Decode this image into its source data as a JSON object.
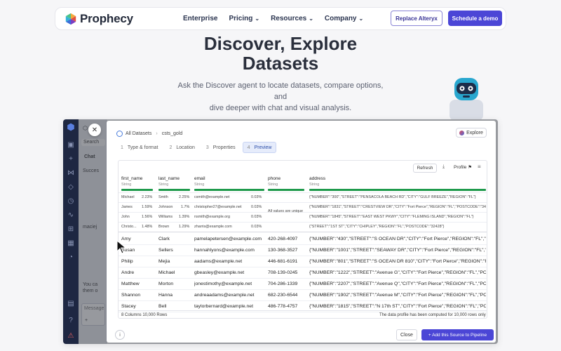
{
  "nav": {
    "brand": "Prophecy",
    "links": [
      {
        "label": "Enterprise",
        "dropdown": false
      },
      {
        "label": "Pricing",
        "dropdown": true
      },
      {
        "label": "Resources",
        "dropdown": true
      },
      {
        "label": "Company",
        "dropdown": true
      }
    ],
    "secondary_button": "Replace Alteryx",
    "primary_button": "Schedule a demo"
  },
  "hero": {
    "title_line1": "Discover, Explore",
    "title_line2": "Datasets",
    "subtitle_line1": "Ask the Discover agent to locate datasets, compare options, and",
    "subtitle_line2": "dive deeper with chat and visual analysis."
  },
  "chat_panel": {
    "tab": "Chat",
    "search": "Search",
    "status": "Succes",
    "user": "maciej",
    "message_placeholder": "Message",
    "snippet1": "You ca",
    "snippet2": "them o"
  },
  "modal": {
    "breadcrumb_root": "All Datasets",
    "breadcrumb_current": "csts_gold",
    "explore_button": "Explore",
    "steps": [
      {
        "num": "1",
        "label": "Type & format"
      },
      {
        "num": "2",
        "label": "Location"
      },
      {
        "num": "3",
        "label": "Properties"
      },
      {
        "num": "4",
        "label": "Preview"
      }
    ],
    "toolbar": {
      "refresh": "Refresh",
      "profile": "Profile"
    },
    "columns": [
      {
        "name": "first_name",
        "type": "String"
      },
      {
        "name": "last_name",
        "type": "String"
      },
      {
        "name": "email",
        "type": "String"
      },
      {
        "name": "phone",
        "type": "String"
      },
      {
        "name": "address",
        "type": "String"
      }
    ],
    "profile": {
      "first_name": [
        [
          "Michael",
          "2.23%"
        ],
        [
          "James",
          "1.59%"
        ],
        [
          "John",
          "1.56%"
        ],
        [
          "Christo...",
          "1.48%"
        ]
      ],
      "last_name": [
        [
          "Smith",
          "2.25%"
        ],
        [
          "Johnson",
          "1.7%"
        ],
        [
          "Williams",
          "1.39%"
        ],
        [
          "Brown",
          "1.29%"
        ]
      ],
      "email": [
        [
          "csmith@example.net",
          "0.03%"
        ],
        [
          "christopher27@example.net",
          "0.03%"
        ],
        [
          "nsmith@example.org",
          "0.03%"
        ],
        [
          "zharris@example.com",
          "0.03%"
        ]
      ],
      "phone_note": "All values are unique",
      "address": [
        "{\"NUMBER\":\"300\",\"STREET\":\"PENSACOLA BEACH RD\",\"CITY\":\"GULF BREEZE\",\"REGION\":\"FL\"}",
        "{\"NUMBER\":\"1831\",\"STREET\":\"CRESTVIEW DR\",\"CITY\":\"Fort Pierce\",\"REGION\":\"FL\",\"POSTCODE\":\"34950\"}",
        "{\"NUMBER\":\"1845\",\"STREET\":\"EAST WEST PKWY\",\"CITY\":\"FLEMING ISLAND\",\"REGION\":\"FL\"}",
        "{\"STREET\":\"1ST ST\",\"CITY\":\"CHIPLEY\",\"REGION\":\"FL\",\"POSTCODE\":\"32428\"}"
      ]
    },
    "rows": [
      [
        "Amy",
        "Clark",
        "pamelapetersen@example.com",
        "420-268-4097",
        "{\"NUMBER\":\"430\",\"STREET\":\"S OCEAN DR\",\"CITY\":\"Fort Pierce\",\"REGION\":\"FL\",\"POSTCODE"
      ],
      [
        "Susan",
        "Sellers",
        "hannahlyons@example.com",
        "130-368-3527",
        "{\"NUMBER\":\"1001\",\"STREET\":\"SEAWAY DR\",\"CITY\":\"Fort Pierce\",\"REGION\":\"FL\",\"POSTCODE"
      ],
      [
        "Philip",
        "Mejia",
        "aadams@example.net",
        "446-681-6191",
        "{\"NUMBER\":\"801\",\"STREET\":\"S OCEAN DR 810\",\"CITY\":\"Fort Pierce\",\"REGION\":\"FL\",\"POSTCODE"
      ],
      [
        "Andre",
        "Michael",
        "gbeasley@example.net",
        "708-139-0245",
        "{\"NUMBER\":\"1222\",\"STREET\":\"Avenue G\",\"CITY\":\"Fort Pierce\",\"REGION\":\"FL\",\"POSTCODE"
      ],
      [
        "Matthew",
        "Morton",
        "jonestimothy@example.net",
        "704-286-1339",
        "{\"NUMBER\":\"2207\",\"STREET\":\"Avenue Q\",\"CITY\":\"Fort Pierce\",\"REGION\":\"FL\",\"POSTCODE"
      ],
      [
        "Shannon",
        "Hanna",
        "andreaadams@example.net",
        "682-230-6544",
        "{\"NUMBER\":\"1902\",\"STREET\":\"Avenue M\",\"CITY\":\"Fort Pierce\",\"REGION\":\"FL\",\"POSTCODE"
      ],
      [
        "Stacey",
        "Bell",
        "taylorbernard@example.net",
        "486-778-4757",
        "{\"NUMBER\":\"1815\",\"STREET\":\"N 17th ST\",\"CITY\":\"Fort Pierce\",\"REGION\":\"FL\",\"POSTCODE"
      ]
    ],
    "footer": {
      "counts": "8 Columns     10,000 Rows",
      "note": "The data profile has been computed for 10,000 rows only"
    },
    "close_button": "Close",
    "add_button": "+ Add this Source to Pipeline"
  },
  "colors": {
    "accent": "#4b46d6",
    "profile_bar": "#1f9a4c",
    "rail": "#1e2742"
  }
}
